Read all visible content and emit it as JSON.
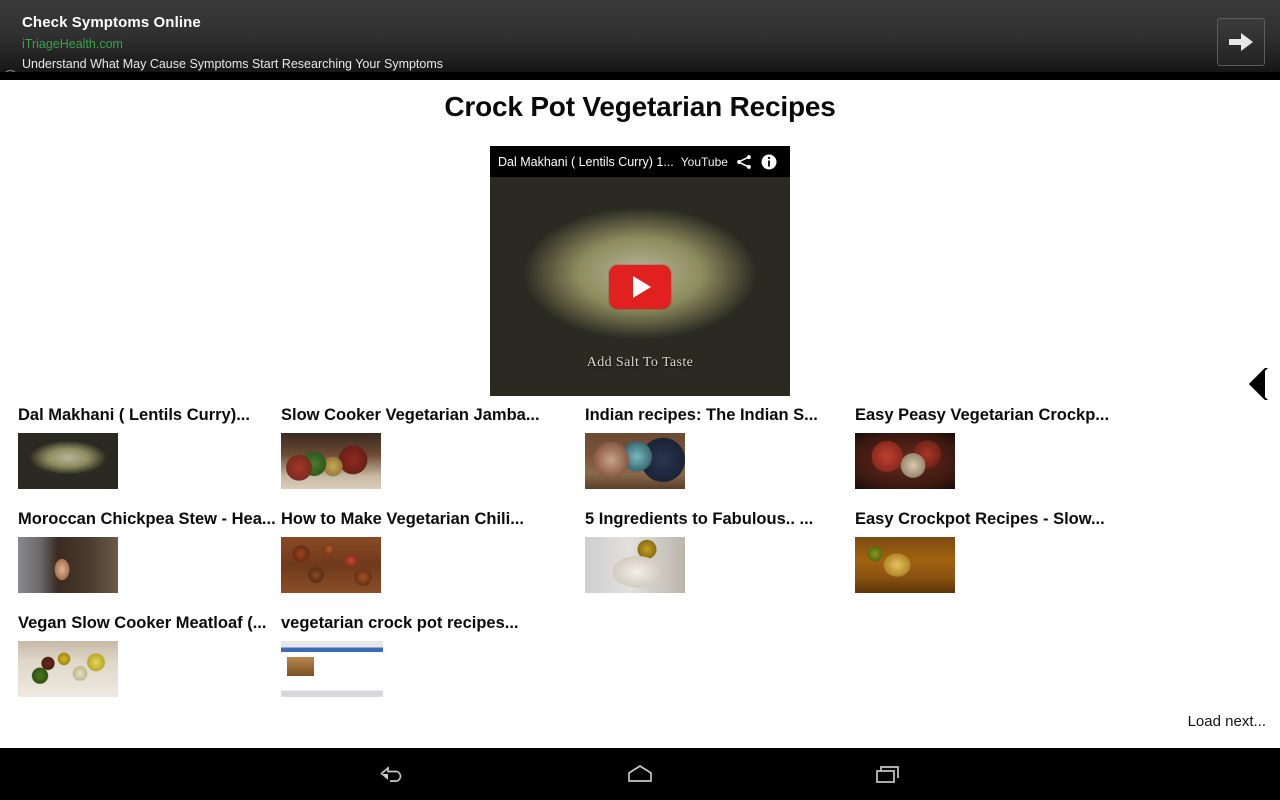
{
  "ad": {
    "headline": "Check Symptoms Online",
    "url": "iTriageHealth.com",
    "description": "Understand What May Cause Symptoms Start Researching Your Symptoms",
    "info_badge": "i",
    "arrow_button_name": "arrow-right",
    "url_color": "#3aa14e"
  },
  "page": {
    "title": "Crock Pot Vegetarian Recipes",
    "load_next": "Load next...",
    "back_chevron": "chevron-left"
  },
  "player": {
    "video_title": "Dal Makhani ( Lentils Curry) 1...",
    "brand": "YouTube",
    "share_icon": "share-icon",
    "info_icon": "info-icon",
    "play_button": "play-button",
    "caption": "Add Salt To Taste",
    "art": "art-crockpot"
  },
  "results": {
    "rows": [
      [
        {
          "title": "Dal Makhani ( Lentils Curry)...",
          "art": "art-crockpot"
        },
        {
          "title": "Slow Cooker Vegetarian Jamba...",
          "art": "art-jars"
        },
        {
          "title": "Indian recipes: The Indian S...",
          "art": "art-tvshow"
        },
        {
          "title": "Easy Peasy Vegetarian Crockp...",
          "art": "art-redstew"
        }
      ],
      [
        {
          "title": "Moroccan Chickpea Stew - Hea...",
          "art": "art-kitchenwoman"
        },
        {
          "title": "How to Make Vegetarian Chili...",
          "art": "art-chili"
        },
        {
          "title": "5 Ingredients to Fabulous.. ...",
          "art": "art-whitepot"
        },
        {
          "title": "Easy Crockpot Recipes - Slow...",
          "art": "art-ladle"
        }
      ],
      [
        {
          "title": "Vegan Slow Cooker Meatloaf (...",
          "art": "art-ingredients"
        },
        {
          "title": "vegetarian crock pot recipes...",
          "art": "art-webpage"
        }
      ]
    ]
  },
  "navbar": {
    "back": "back-button",
    "home": "home-button",
    "recents": "recents-button"
  }
}
